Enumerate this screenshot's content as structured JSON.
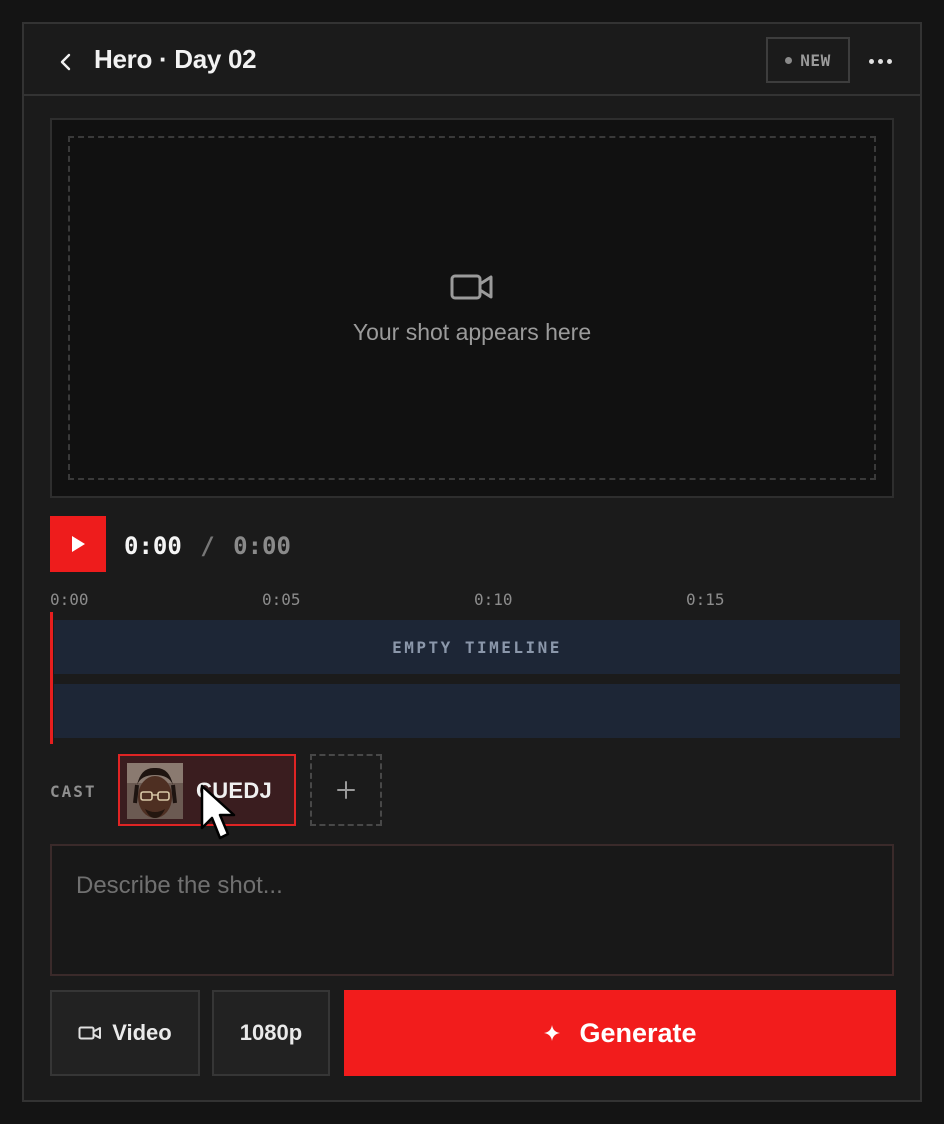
{
  "header": {
    "title": "Hero · Day 02",
    "badge": "NEW"
  },
  "preview": {
    "placeholder": "Your shot appears here"
  },
  "player": {
    "current_time": "0:00",
    "separator": "/",
    "duration": "0:00"
  },
  "timeline": {
    "ticks": [
      "0:00",
      "0:05",
      "0:10",
      "0:15"
    ],
    "empty_label": "EMPTY TIMELINE"
  },
  "cast": {
    "label": "CAST",
    "members": [
      {
        "name": "CUEDJ"
      }
    ]
  },
  "prompt": {
    "placeholder": "Describe the shot..."
  },
  "controls": {
    "mode_label": "Video",
    "resolution_label": "1080p",
    "generate_label": "Generate"
  },
  "colors": {
    "accent": "#f21c1c",
    "background": "#141414",
    "panel": "#1b1b1b",
    "track": "#1d2636"
  }
}
